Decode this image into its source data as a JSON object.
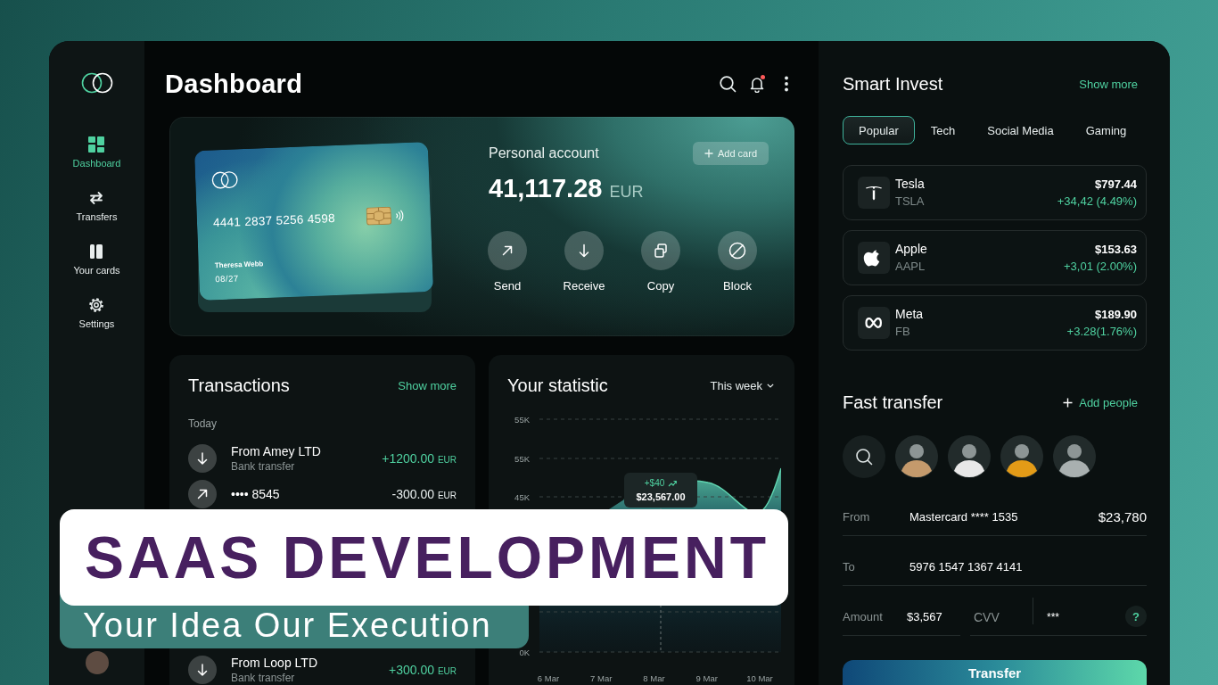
{
  "sidebar": {
    "items": [
      {
        "label": "Dashboard",
        "selected": true
      },
      {
        "label": "Transfers",
        "selected": false
      },
      {
        "label": "Your cards",
        "selected": false
      },
      {
        "label": "Settings",
        "selected": false
      }
    ]
  },
  "header": {
    "title": "Dashboard",
    "notification": true
  },
  "account": {
    "card": {
      "number": "4441 2837 5256 4598",
      "holder": "Theresa Webb",
      "expiry": "08/27"
    },
    "label": "Personal account",
    "balance": "41,117.28",
    "currency": "EUR",
    "add_button": "Add card",
    "actions": [
      {
        "label": "Send"
      },
      {
        "label": "Receive"
      },
      {
        "label": "Copy"
      },
      {
        "label": "Block"
      }
    ]
  },
  "transactions": {
    "title": "Transactions",
    "link": "Show more",
    "group": "Today",
    "rows": [
      {
        "kind": "incoming",
        "name": "From Amey LTD",
        "method": "Bank transfer",
        "amount": "+1200.00",
        "currency": "EUR"
      },
      {
        "kind": "outgoing",
        "name": "•••• 8545",
        "amount": "-300.00",
        "currency": "EUR"
      }
    ],
    "more_rows": [
      {
        "kind": "incoming",
        "name": "From Loop LTD",
        "method": "Bank transfer",
        "amount": "+300.00",
        "currency": "EUR"
      }
    ]
  },
  "statistic": {
    "title": "Your statistic",
    "period": "This week",
    "y_labels": [
      "55K",
      "55K",
      "45K"
    ],
    "y_label_bottom": "0K",
    "x_labels": [
      "6 Mar",
      "7 Mar",
      "8 Mar",
      "9 Mar",
      "10 Mar"
    ],
    "tooltip": {
      "change": "+$40",
      "value": "$23,567.00"
    }
  },
  "invest": {
    "title": "Smart Invest",
    "link": "Show more",
    "tabs": [
      {
        "label": "Popular",
        "selected": true
      },
      {
        "label": "Tech",
        "selected": false
      },
      {
        "label": "Social Media",
        "selected": false
      },
      {
        "label": "Gaming",
        "selected": false
      }
    ],
    "stocks": [
      {
        "name": "Tesla",
        "ticker": "TSLA",
        "price": "$797.44",
        "change": "+34,42 (4.49%)"
      },
      {
        "name": "Apple",
        "ticker": "AAPL",
        "price": "$153.63",
        "change": "+3,01 (2.00%)"
      },
      {
        "name": "Meta",
        "ticker": "FB",
        "price": "$189.90",
        "change": "+3.28(1.76%)"
      }
    ]
  },
  "fast_transfer": {
    "title": "Fast transfer",
    "add_link": "Add people",
    "contacts": [
      {
        "color": "#c49a6c"
      },
      {
        "color": "#e8e8e8"
      },
      {
        "color": "#e39b17"
      },
      {
        "color": "#a9b0b0"
      }
    ],
    "from": {
      "label": "From",
      "value": "Mastercard **** 1535",
      "balance": "$23,780"
    },
    "to": {
      "label": "To",
      "value": "5976 1547 1367 4141"
    },
    "amount": {
      "label": "Amount",
      "value": "$3,567"
    },
    "cvv": {
      "label": "CVV",
      "value": "***",
      "help": "?"
    },
    "button": "Transfer"
  },
  "banner": {
    "title": "SAAS DEVELOPMENT",
    "subtitle": "Your Idea Our Execution"
  }
}
